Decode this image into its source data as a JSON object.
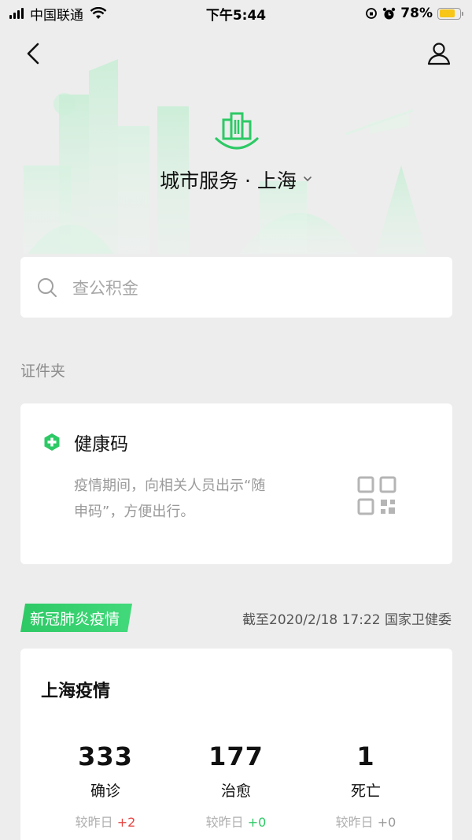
{
  "status_bar": {
    "carrier": "中国联通",
    "time": "下午5:44",
    "battery_percent": "78%",
    "battery_level": 0.78
  },
  "nav": {
    "back_icon": "chevron-left-icon",
    "profile_icon": "user-icon"
  },
  "city": {
    "title": "城市服务 · 上海",
    "logo_icon": "city-buildings-icon",
    "dropdown_icon": "chevron-down-icon"
  },
  "search": {
    "placeholder": "查公积金"
  },
  "wallet": {
    "section_label": "证件夹",
    "health_code": {
      "title": "健康码",
      "description": "疫情期间，向相关人员出示“随申码”，方便出行。",
      "description_line1": "疫情期间，向相关人员出示“随",
      "description_line2": "申码”，方便出行。"
    }
  },
  "epidemic": {
    "tag": "新冠肺炎疫情",
    "source": "截至2020/2/18 17:22 国家卫健委",
    "card_title": "上海疫情",
    "stats": [
      {
        "value": "333",
        "label": "确诊",
        "delta_prefix": "较昨日",
        "delta": "+2"
      },
      {
        "value": "177",
        "label": "治愈",
        "delta_prefix": "较昨日",
        "delta": "+0"
      },
      {
        "value": "1",
        "label": "死亡",
        "delta_prefix": "较昨日",
        "delta": "+0"
      }
    ]
  },
  "colors": {
    "accent_green": "#2dc965",
    "delta_red": "#e64340",
    "background": "#ededed"
  }
}
